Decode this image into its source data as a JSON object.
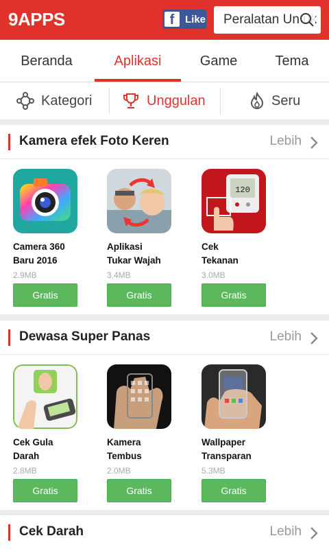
{
  "header": {
    "logo": "9APPS",
    "fb_like_label": "Like",
    "search_placeholder": "Peralatan Untuk"
  },
  "tabs": [
    {
      "label": "Beranda",
      "active": false
    },
    {
      "label": "Aplikasi",
      "active": true
    },
    {
      "label": "Game",
      "active": false
    },
    {
      "label": "Tema",
      "active": false
    }
  ],
  "subtabs": [
    {
      "label": "Kategori",
      "icon": "category-icon",
      "active": false
    },
    {
      "label": "Unggulan",
      "icon": "trophy-icon",
      "active": true
    },
    {
      "label": "Seru",
      "icon": "flame-icon",
      "active": false
    }
  ],
  "sections": [
    {
      "title": "Kamera efek Foto Keren",
      "more": "Lebih",
      "apps": [
        {
          "name_line1": "Camera 360",
          "name_line2": "Baru 2016",
          "size": "2.9MB",
          "button": "Gratis"
        },
        {
          "name_line1": "Aplikasi",
          "name_line2": "Tukar Wajah",
          "size": "3.4MB",
          "button": "Gratis"
        },
        {
          "name_line1": "Cek",
          "name_line2": "Tekanan",
          "size": "3.0MB",
          "button": "Gratis"
        }
      ]
    },
    {
      "title": "Dewasa Super Panas",
      "more": "Lebih",
      "apps": [
        {
          "name_line1": "Cek Gula",
          "name_line2": "Darah",
          "size": "2.8MB",
          "button": "Gratis"
        },
        {
          "name_line1": "Kamera",
          "name_line2": "Tembus",
          "size": "2.0MB",
          "button": "Gratis"
        },
        {
          "name_line1": "Wallpaper",
          "name_line2": "Transparan",
          "size": "5.3MB",
          "button": "Gratis"
        }
      ]
    },
    {
      "title": "Cek Darah",
      "more": "Lebih",
      "apps": []
    }
  ],
  "colors": {
    "brand": "#e0312b",
    "button": "#5cb85c",
    "facebook": "#3b5998"
  }
}
